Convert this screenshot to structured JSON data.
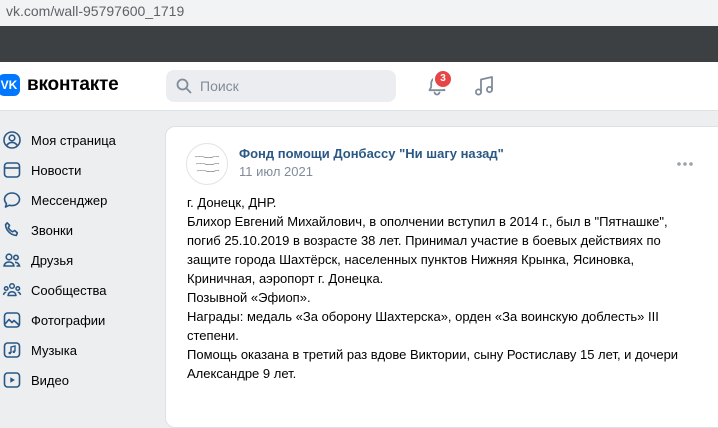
{
  "browser": {
    "url": "vk.com/wall-95797600_1719"
  },
  "header": {
    "logo_mark": "VK",
    "logo_text": "вконтакте",
    "search_placeholder": "Поиск",
    "notifications_count": "3"
  },
  "sidebar": {
    "items": [
      {
        "label": "Моя страница",
        "icon": "user-circle-icon"
      },
      {
        "label": "Новости",
        "icon": "news-icon"
      },
      {
        "label": "Мессенджер",
        "icon": "message-icon"
      },
      {
        "label": "Звонки",
        "icon": "phone-icon"
      },
      {
        "label": "Друзья",
        "icon": "friends-icon"
      },
      {
        "label": "Сообщества",
        "icon": "communities-icon"
      },
      {
        "label": "Фотографии",
        "icon": "photo-icon"
      },
      {
        "label": "Музыка",
        "icon": "music-icon"
      },
      {
        "label": "Видео",
        "icon": "video-icon"
      }
    ]
  },
  "post": {
    "author": "Фонд помощи Донбассу \"Ни шагу назад\"",
    "date": "11 июл 2021",
    "avatar_text": "Фонд помощи Донбассу Ни шагу назад",
    "lines": [
      "г. Донецк, ДНР.",
      "Блихор Евгений Михайлович, в ополчении вступил в 2014 г., был в \"Пятнашке\",",
      "погиб 25.10.2019 в возрасте 38 лет. Принимал участие в боевых действиях по",
      "защите города Шахтёрск, населенных пунктов Нижняя Крынка, Ясиновка,",
      "Криничная, аэропорт г. Донецка.",
      "Позывной «Эфиоп».",
      "Награды: медаль «За оборону Шахтерска», орден «За воинскую доблесть» III",
      "степени.",
      "Помощь оказана в третий раз вдове Виктории, сыну Ростиславу 15 лет, и дочери",
      "Александре 9 лет."
    ]
  },
  "colors": {
    "accent": "#0077ff",
    "link": "#2a5885",
    "badge": "#e64646",
    "icon": "#2a5885"
  }
}
